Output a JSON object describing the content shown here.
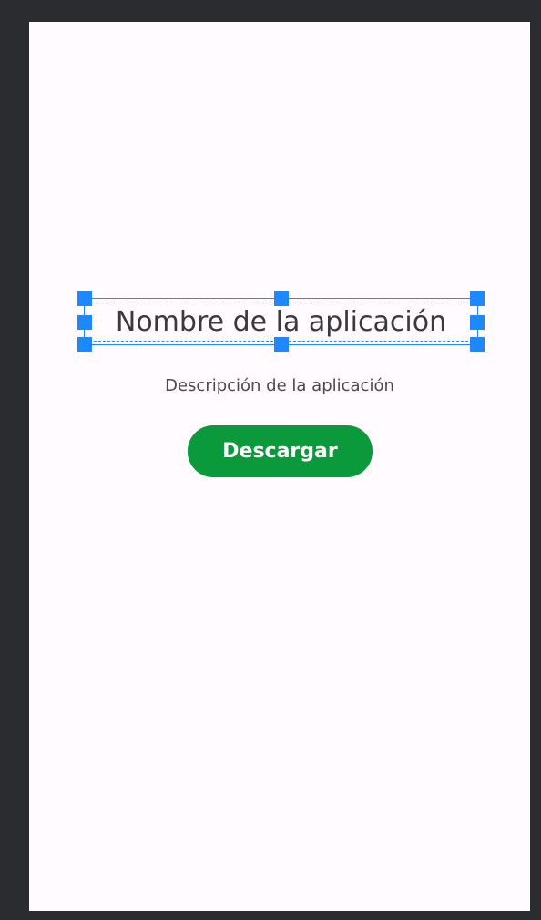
{
  "app": {
    "title": "Nombre de la aplicación",
    "description": "Descripción de la aplicación",
    "download_label": "Descargar"
  },
  "colors": {
    "editor_background": "#2b2c30",
    "screen_background": "#fffbfe",
    "selection_accent": "#1e88ff",
    "button_background": "#0a9a3c",
    "button_text": "#ffffff",
    "title_text": "#3a3a3e",
    "description_text": "#4a4a4e"
  }
}
